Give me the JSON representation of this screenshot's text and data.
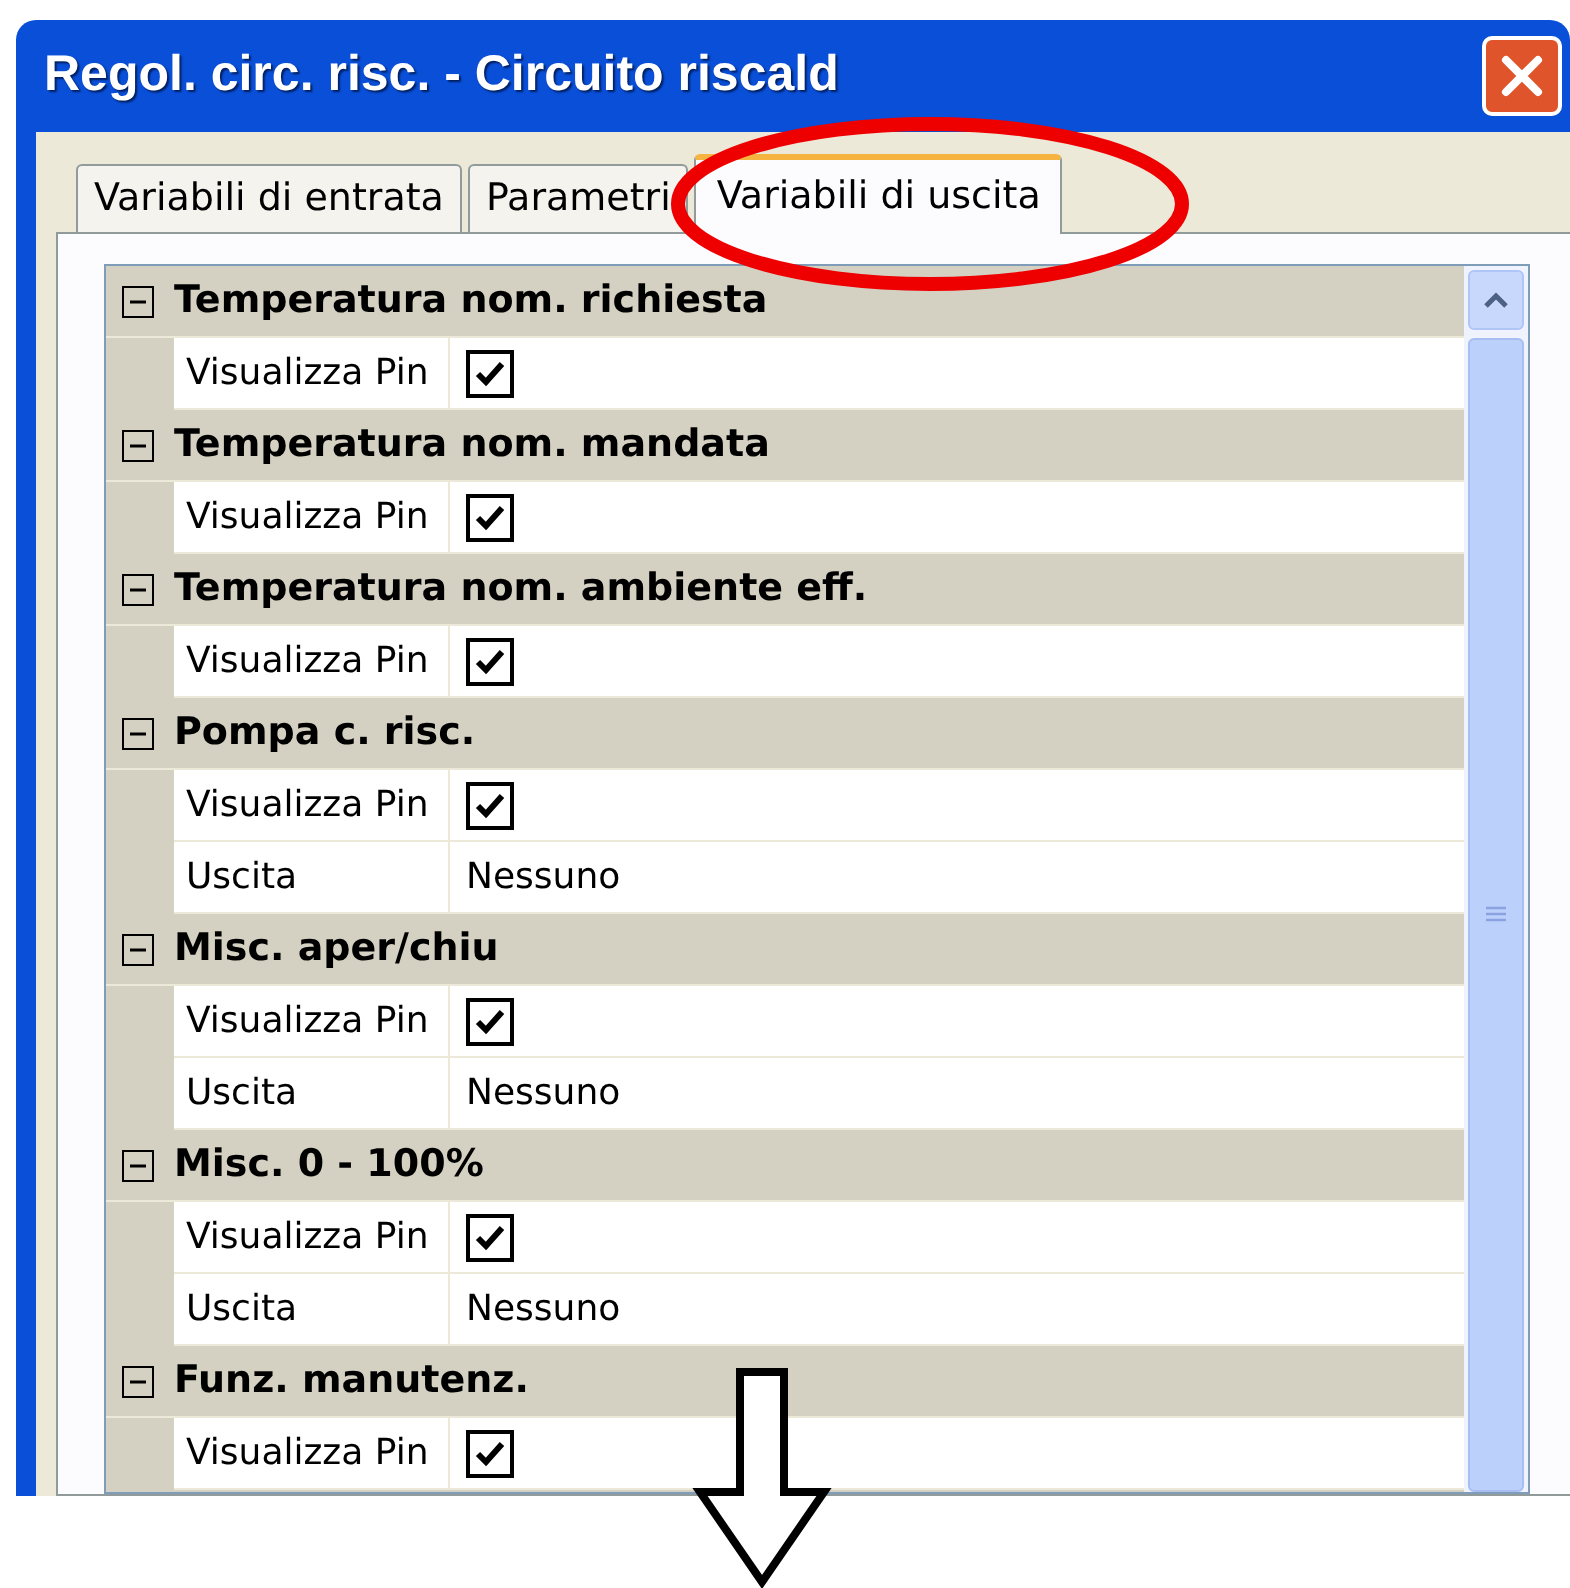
{
  "window": {
    "title": "Regol. circ. risc. - Circuito riscald"
  },
  "tabs": [
    {
      "label": "Variabili di entrata",
      "selected": false
    },
    {
      "label": "Parametri",
      "selected": false
    },
    {
      "label": "Variabili di uscita",
      "selected": true
    }
  ],
  "groups": [
    {
      "title": "Temperatura nom. richiesta",
      "expanded": true,
      "rows": [
        {
          "kind": "checkbox",
          "label": "Visualizza Pin",
          "checked": true
        }
      ]
    },
    {
      "title": "Temperatura nom. mandata",
      "expanded": true,
      "rows": [
        {
          "kind": "checkbox",
          "label": "Visualizza Pin",
          "checked": true
        }
      ]
    },
    {
      "title": "Temperatura nom. ambiente eff.",
      "expanded": true,
      "rows": [
        {
          "kind": "checkbox",
          "label": "Visualizza Pin",
          "checked": true
        }
      ]
    },
    {
      "title": "Pompa c. risc.",
      "expanded": true,
      "rows": [
        {
          "kind": "checkbox",
          "label": "Visualizza Pin",
          "checked": true
        },
        {
          "kind": "text",
          "label": "Uscita",
          "value": "Nessuno"
        }
      ]
    },
    {
      "title": "Misc. aper/chiu",
      "expanded": true,
      "rows": [
        {
          "kind": "checkbox",
          "label": "Visualizza Pin",
          "checked": true
        },
        {
          "kind": "text",
          "label": "Uscita",
          "value": "Nessuno"
        }
      ]
    },
    {
      "title": "Misc. 0 - 100%",
      "expanded": true,
      "rows": [
        {
          "kind": "checkbox",
          "label": "Visualizza Pin",
          "checked": true
        },
        {
          "kind": "text",
          "label": "Uscita",
          "value": "Nessuno"
        }
      ]
    },
    {
      "title": "Funz. manutenz.",
      "expanded": true,
      "rows": [
        {
          "kind": "checkbox",
          "label": "Visualizza Pin",
          "checked": true
        }
      ]
    }
  ]
}
